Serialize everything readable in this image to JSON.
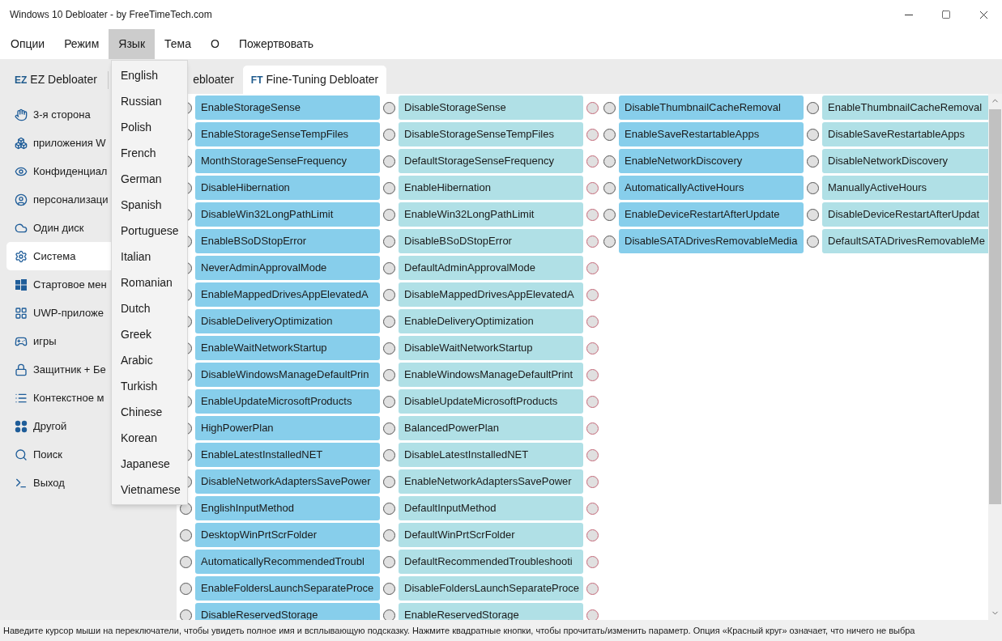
{
  "window": {
    "title": "Windows 10 Debloater - by FreeTimeTech.com"
  },
  "menu": [
    {
      "label": "Опции",
      "selected": false
    },
    {
      "label": "Режим",
      "selected": false
    },
    {
      "label": "Язык",
      "selected": true
    },
    {
      "label": "Тема",
      "selected": false
    },
    {
      "label": "О",
      "selected": false
    },
    {
      "label": "Пожертвовать",
      "selected": false
    }
  ],
  "language_menu": [
    "English",
    "Russian",
    "Polish",
    "French",
    "German",
    "Spanish",
    "Portuguese",
    "Italian",
    "Romanian",
    "Dutch",
    "Greek",
    "Arabic",
    "Turkish",
    "Chinese",
    "Korean",
    "Japanese",
    "Vietnamese"
  ],
  "tabs": [
    {
      "badge": "EZ",
      "label": "EZ Debloater",
      "selected": false
    },
    {
      "label": "ebloater",
      "selected": false
    },
    {
      "badge": "FT",
      "label": "Fine-Tuning Debloater",
      "selected": true
    }
  ],
  "sidebar": [
    {
      "label": "3-я сторона",
      "selected": false
    },
    {
      "label": "приложения W",
      "selected": false
    },
    {
      "label": "Конфиденциал",
      "selected": false
    },
    {
      "label": "персонализаци",
      "selected": false
    },
    {
      "label": "Один диск",
      "selected": false
    },
    {
      "label": "Система",
      "selected": true
    },
    {
      "label": "Стартовое мен",
      "selected": false
    },
    {
      "label": "UWP-приложе",
      "selected": false
    },
    {
      "label": "игры",
      "selected": false
    },
    {
      "label": "Защитник + Бе",
      "selected": false
    },
    {
      "label": "Контекстное м",
      "selected": false
    },
    {
      "label": "Другой",
      "selected": false
    },
    {
      "label": "Поиск",
      "selected": false
    },
    {
      "label": "Выход",
      "selected": false
    }
  ],
  "settings_columns": [
    [
      {
        "option_a": "EnableStorageSense",
        "option_b": "DisableStorageSense",
        "a_selected": false,
        "b_selected": false,
        "none_selected": false
      },
      {
        "option_a": "EnableStorageSenseTempFiles",
        "option_b": "DisableStorageSenseTempFiles",
        "a_selected": false,
        "b_selected": false,
        "none_selected": false
      },
      {
        "option_a": "MonthStorageSenseFrequency",
        "option_b": "DefaultStorageSenseFrequency",
        "a_selected": false,
        "b_selected": false,
        "none_selected": false
      },
      {
        "option_a": "DisableHibernation",
        "option_b": "EnableHibernation",
        "a_selected": false,
        "b_selected": false,
        "none_selected": false
      },
      {
        "option_a": "DisableWin32LongPathLimit",
        "option_b": "EnableWin32LongPathLimit",
        "a_selected": false,
        "b_selected": false,
        "none_selected": false
      },
      {
        "option_a": "EnableBSoDStopError",
        "option_b": "DisableBSoDStopError",
        "a_selected": false,
        "b_selected": false,
        "none_selected": false
      },
      {
        "option_a": "NeverAdminApprovalMode",
        "option_b": "DefaultAdminApprovalMode",
        "a_selected": false,
        "b_selected": false,
        "none_selected": false
      },
      {
        "option_a": "EnableMappedDrivesAppElevatedA",
        "option_b": "DisableMappedDrivesAppElevatedA",
        "a_selected": false,
        "b_selected": false,
        "none_selected": false
      },
      {
        "option_a": "DisableDeliveryOptimization",
        "option_b": "EnableDeliveryOptimization",
        "a_selected": false,
        "b_selected": false,
        "none_selected": false
      },
      {
        "option_a": "EnableWaitNetworkStartup",
        "option_b": "DisableWaitNetworkStartup",
        "a_selected": false,
        "b_selected": false,
        "none_selected": false
      },
      {
        "option_a": "DisableWindowsManageDefaultPrin",
        "option_b": "EnableWindowsManageDefaultPrint",
        "a_selected": false,
        "b_selected": false,
        "none_selected": false
      },
      {
        "option_a": "EnableUpdateMicrosoftProducts",
        "option_b": "DisableUpdateMicrosoftProducts",
        "a_selected": false,
        "b_selected": false,
        "none_selected": false
      },
      {
        "option_a": "HighPowerPlan",
        "option_b": "BalancedPowerPlan",
        "a_selected": false,
        "b_selected": false,
        "none_selected": false
      },
      {
        "option_a": "EnableLatestInstalledNET",
        "option_b": "DisableLatestInstalledNET",
        "a_selected": false,
        "b_selected": false,
        "none_selected": false
      },
      {
        "option_a": "DisableNetworkAdaptersSavePower",
        "option_b": "EnableNetworkAdaptersSavePower",
        "a_selected": false,
        "b_selected": false,
        "none_selected": false
      },
      {
        "option_a": "EnglishInputMethod",
        "option_b": "DefaultInputMethod",
        "a_selected": false,
        "b_selected": false,
        "none_selected": false
      },
      {
        "option_a": "DesktopWinPrtScrFolder",
        "option_b": "DefaultWinPrtScrFolder",
        "a_selected": false,
        "b_selected": false,
        "none_selected": false
      },
      {
        "option_a": "AutomaticallyRecommendedTroubl",
        "option_b": "DefaultRecommendedTroubleshooti",
        "a_selected": false,
        "b_selected": false,
        "none_selected": false
      },
      {
        "option_a": "EnableFoldersLaunchSeparateProce",
        "option_b": "DisableFoldersLaunchSeparateProce",
        "a_selected": false,
        "b_selected": false,
        "none_selected": false
      },
      {
        "option_a": "DisableReservedStorage",
        "option_b": "EnableReservedStorage",
        "a_selected": false,
        "b_selected": false,
        "none_selected": false
      }
    ],
    [
      {
        "option_a": "DisableThumbnailCacheRemoval",
        "option_b": "EnableThumbnailCacheRemoval",
        "a_selected": false,
        "b_selected": false
      },
      {
        "option_a": "EnableSaveRestartableApps",
        "option_b": "DisableSaveRestartableApps",
        "a_selected": false,
        "b_selected": false
      },
      {
        "option_a": "EnableNetworkDiscovery",
        "option_b": "DisableNetworkDiscovery",
        "a_selected": false,
        "b_selected": false
      },
      {
        "option_a": "AutomaticallyActiveHours",
        "option_b": "ManuallyActiveHours",
        "a_selected": false,
        "b_selected": false
      },
      {
        "option_a": "EnableDeviceRestartAfterUpdate",
        "option_b": "DisableDeviceRestartAfterUpdat",
        "a_selected": false,
        "b_selected": false
      },
      {
        "option_a": "DisableSATADrivesRemovableMedia",
        "option_b": "DefaultSATADrivesRemovableMe",
        "a_selected": false,
        "b_selected": false
      }
    ]
  ],
  "status_bar": "Наведите курсор мыши на переключатели, чтобы увидеть полное имя и всплывающую подсказку. Нажмите квадратные кнопки, чтобы прочитать/изменить параметр. Опция «Красный круг» означает, что ничего не выбра"
}
